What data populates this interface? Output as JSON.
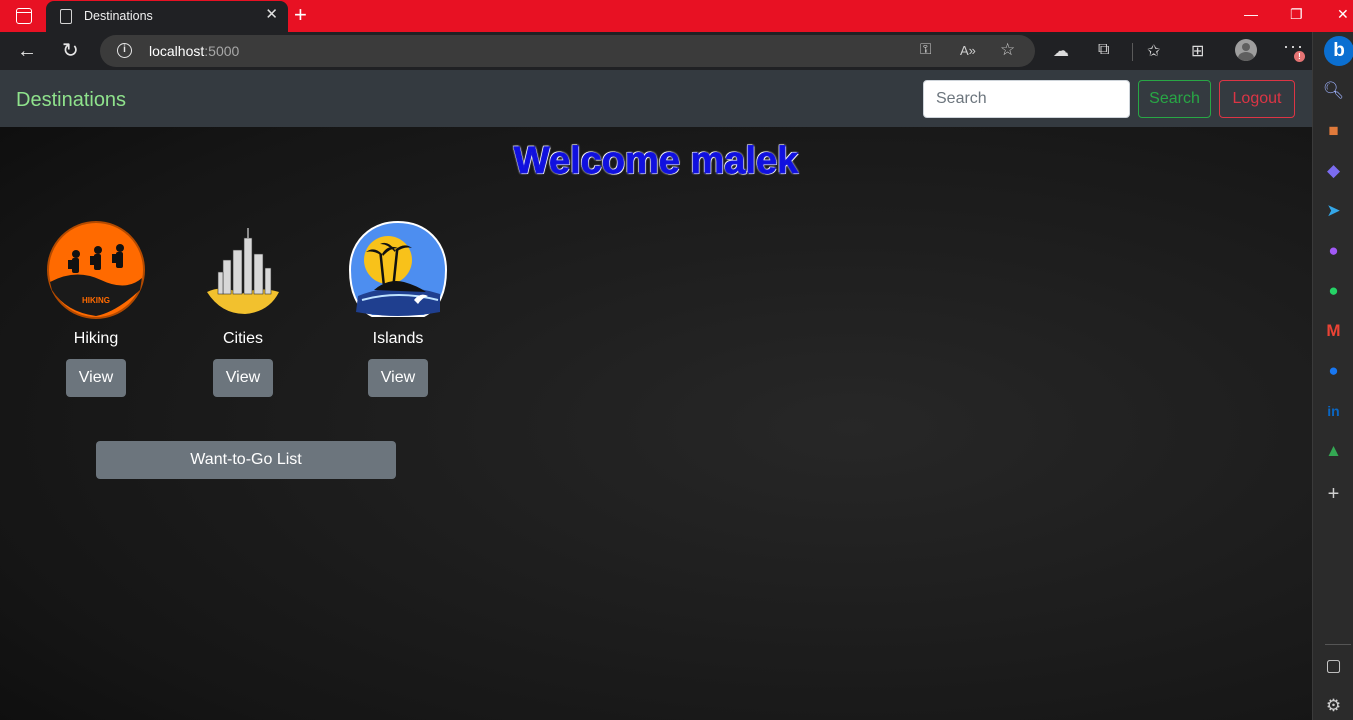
{
  "browser": {
    "tab_title": "Destinations",
    "tab_close": "✕",
    "new_tab": "+",
    "url_host": "localhost",
    "url_port": ":5000",
    "window_controls": {
      "minimize": "—",
      "restore": "❐",
      "close": "✕"
    },
    "alert_badge": "!"
  },
  "navbar": {
    "brand": "Destinations",
    "search_placeholder": "Search",
    "search_button": "Search",
    "logout_button": "Logout"
  },
  "welcome": {
    "prefix": "Welcome ",
    "username": "malek"
  },
  "categories": [
    {
      "label": "Hiking",
      "button": "View",
      "icon": "hiking-logo",
      "badge_text": "HIKING"
    },
    {
      "label": "Cities",
      "button": "View",
      "icon": "city-skyline-logo"
    },
    {
      "label": "Islands",
      "button": "View",
      "icon": "island-palm-logo"
    }
  ],
  "want_to_go_button": "Want-to-Go List",
  "colors": {
    "brand": "#8fe28c",
    "navbar": "#343a40",
    "search_outline": "#28a745",
    "logout_outline": "#dc3545",
    "welcome_text": "#1a1ad9",
    "secondary_button": "#6c757d",
    "titlebar": "#e81123"
  }
}
